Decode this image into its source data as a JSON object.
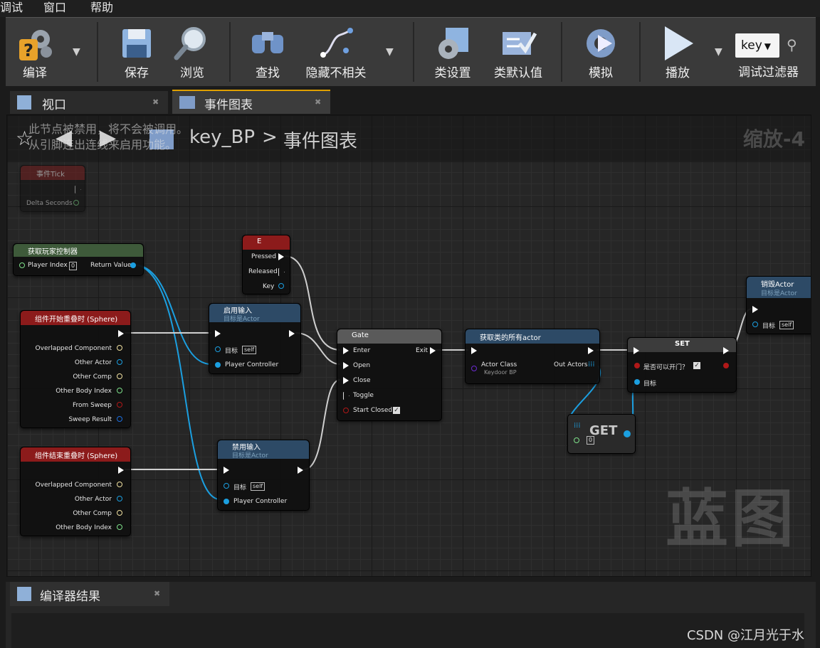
{
  "menu": {
    "items": [
      "调试",
      "窗口",
      "帮助"
    ]
  },
  "toolbar": {
    "compile": "编译",
    "save": "保存",
    "browse": "浏览",
    "find": "查找",
    "hide_unrelated": "隐藏不相关",
    "class_settings": "类设置",
    "class_defaults": "类默认值",
    "simulate": "模拟",
    "play": "播放",
    "debug_filter": "调试过滤器",
    "debug_value": "key"
  },
  "tabs": {
    "viewport": "视口",
    "event_graph": "事件图表"
  },
  "breadcrumb": {
    "blueprint": "key_BP",
    "graph": "事件图表",
    "zoom": "缩放-4"
  },
  "disabled_note": {
    "line1": "此节点被禁用，将不会被调用。",
    "line2": "从引脚连出连线来启用功能。"
  },
  "nodes": {
    "tick": {
      "title": "事件Tick",
      "pin_delta": "Delta Seconds"
    },
    "get_player_controller": {
      "title": "获取玩家控制器",
      "player_index": "Player Index",
      "index_value": "0",
      "return_value": "Return Value"
    },
    "key_e": {
      "title": "E",
      "pressed": "Pressed",
      "released": "Released",
      "key": "Key"
    },
    "enable_input": {
      "title": "启用输入",
      "subtitle": "目标是Actor",
      "target": "目标",
      "target_value": "self",
      "player_controller": "Player Controller"
    },
    "disable_input": {
      "title": "禁用输入",
      "subtitle": "目标是Actor",
      "target": "目标",
      "target_value": "self",
      "player_controller": "Player Controller"
    },
    "begin_overlap": {
      "title": "组件开始重叠时 (Sphere)",
      "pins": [
        "Overlapped Component",
        "Other Actor",
        "Other Comp",
        "Other Body Index",
        "From Sweep",
        "Sweep Result"
      ]
    },
    "end_overlap": {
      "title": "组件结束重叠时 (Sphere)",
      "pins": [
        "Overlapped Component",
        "Other Actor",
        "Other Comp",
        "Other Body Index"
      ]
    },
    "gate": {
      "title": "Gate",
      "enter": "Enter",
      "exit": "Exit",
      "open": "Open",
      "close": "Close",
      "toggle": "Toggle",
      "start_closed": "Start Closed"
    },
    "get_all_actors": {
      "title": "获取类的所有actor",
      "actor_class": "Actor Class",
      "actor_class_value": "Keydoor BP",
      "out_actors": "Out Actors"
    },
    "set": {
      "title": "SET",
      "var": "是否可以开门？",
      "target": "目标"
    },
    "get": {
      "title": "GET",
      "index": "0"
    },
    "destroy_actor": {
      "title": "销毁Actor",
      "subtitle": "目标是Actor",
      "target": "目标",
      "target_value": "self"
    }
  },
  "watermark": "蓝图",
  "compiler_results": {
    "tab": "编译器结果"
  },
  "credit": "CSDN @江月光于水"
}
